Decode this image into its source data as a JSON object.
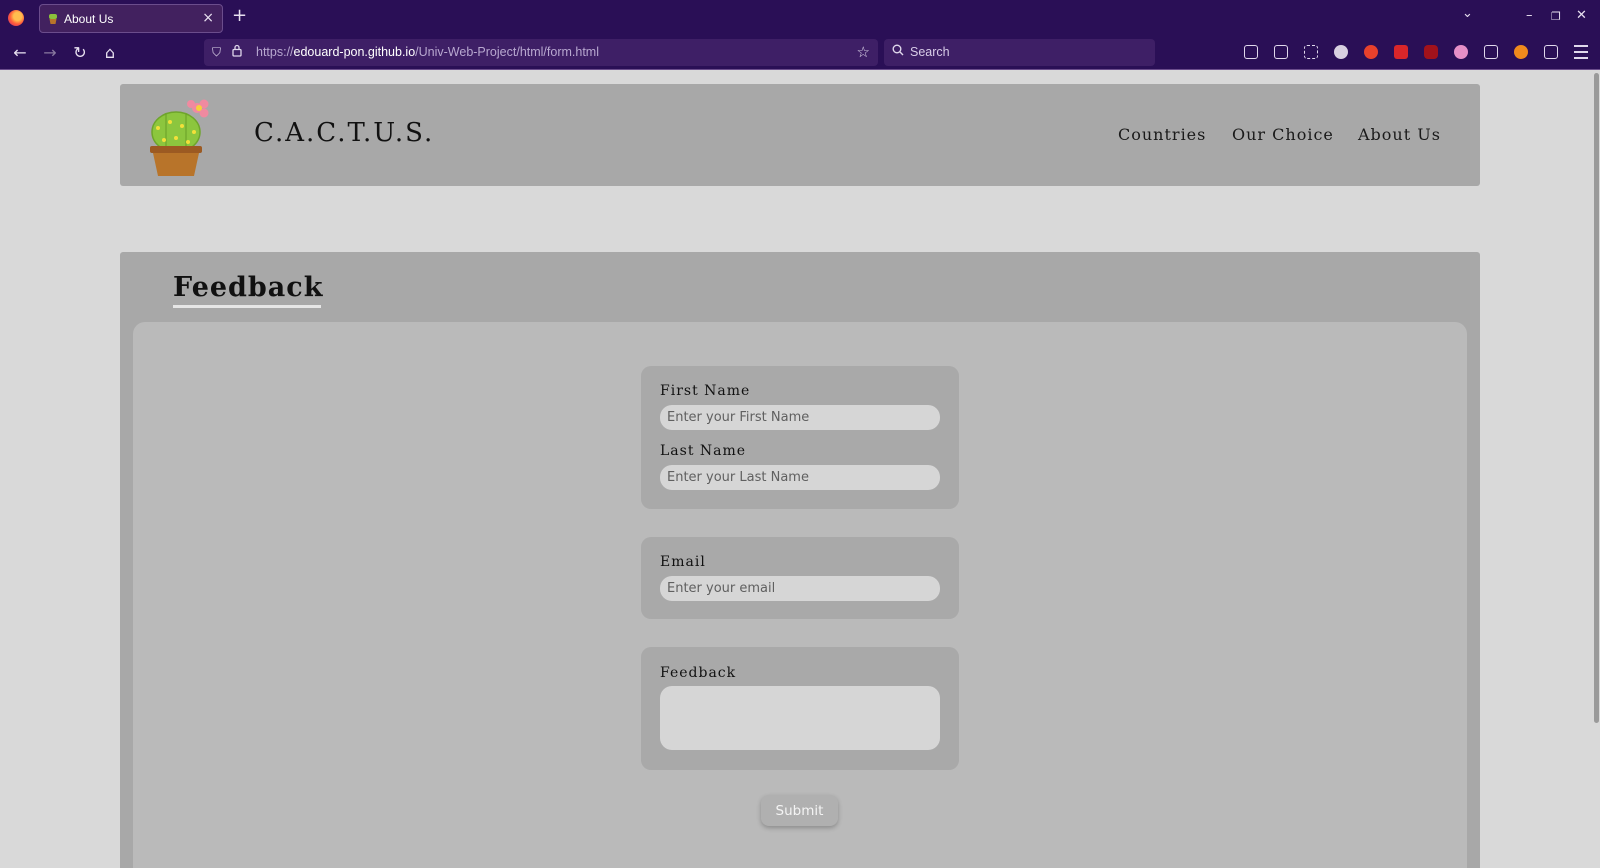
{
  "browser": {
    "tab_title": "About Us",
    "tab_close": "×",
    "new_tab": "+",
    "tab_list": "⌄",
    "window_controls": {
      "minimize": "–",
      "restore": "❐",
      "close": "✕"
    },
    "nav": {
      "back": "←",
      "forward": "→",
      "reload": "↻",
      "home": "⌂"
    },
    "url": {
      "scheme": "https://",
      "host": "edouard-pon.github.io",
      "path": "/Univ-Web-Project/html/form.html"
    },
    "bookmark_star": "☆",
    "search_placeholder": "Search",
    "extension_icons": [
      "library-icon",
      "reader-icon",
      "tab-grid-icon",
      "ghost-extension-icon",
      "red-extension-icon",
      "red-pen-extension-icon",
      "ublock-icon",
      "pink-extension-icon",
      "wallet-icon",
      "brave-extension-icon",
      "puzzle-icon",
      "menu-icon"
    ]
  },
  "site": {
    "title": "C.A.C.T.U.S.",
    "nav": [
      "Countries",
      "Our Choice",
      "About Us"
    ]
  },
  "form": {
    "heading": "Feedback",
    "first_name": {
      "label": "First Name",
      "placeholder": "Enter your First Name"
    },
    "last_name": {
      "label": "Last Name",
      "placeholder": "Enter your Last Name"
    },
    "email": {
      "label": "Email",
      "placeholder": "Enter your email"
    },
    "feedback": {
      "label": "Feedback"
    },
    "submit_label": "Submit"
  },
  "colors": {
    "browser_chrome": "#2a0f56",
    "page_bg": "#d9d9d9",
    "panel": "#a8a8a8",
    "inner_panel": "#bababa",
    "input_bg": "#d6d6d6"
  }
}
